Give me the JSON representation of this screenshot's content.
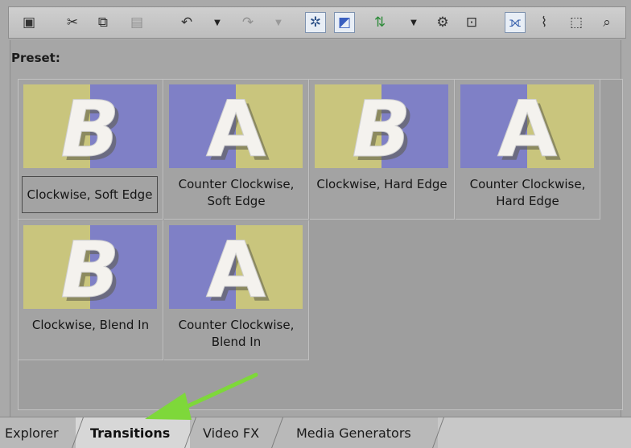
{
  "toolbar": {
    "icons": [
      "properties-icon",
      "cut-icon",
      "copy-icon",
      "paste-icon",
      "undo-icon",
      "undo-dropdown-icon",
      "redo-icon",
      "redo-dropdown-icon",
      "snap-icon",
      "auto-ripple-icon",
      "event-envelope-icon",
      "envelope-dropdown-icon",
      "fx-chain-icon",
      "lock-envelope-icon",
      "normal-edit-tool-icon",
      "envelope-tool-icon",
      "selection-tool-icon",
      "zoom-tool-icon"
    ]
  },
  "panel": {
    "preset_label": "Preset:",
    "presets": [
      {
        "caption": "Clockwise, Soft Edge",
        "letter": "B",
        "selected": true
      },
      {
        "caption": "Counter Clockwise, Soft Edge",
        "letter": "A",
        "selected": false
      },
      {
        "caption": "Clockwise, Hard Edge",
        "letter": "B",
        "selected": false
      },
      {
        "caption": "Counter Clockwise, Hard Edge",
        "letter": "A",
        "selected": false
      },
      {
        "caption": "Clockwise, Blend In",
        "letter": "B",
        "selected": false
      },
      {
        "caption": "Counter Clockwise, Blend In",
        "letter": "A",
        "selected": false
      }
    ]
  },
  "tabs": [
    {
      "label": "Explorer",
      "active": false
    },
    {
      "label": "Transitions",
      "active": true
    },
    {
      "label": "Video FX",
      "active": false
    },
    {
      "label": "Media Generators",
      "active": false
    }
  ],
  "colors": {
    "thumb_yellow": "#c9c57d",
    "thumb_blue": "#7f80c6",
    "arrow_green": "#7ed83a"
  }
}
